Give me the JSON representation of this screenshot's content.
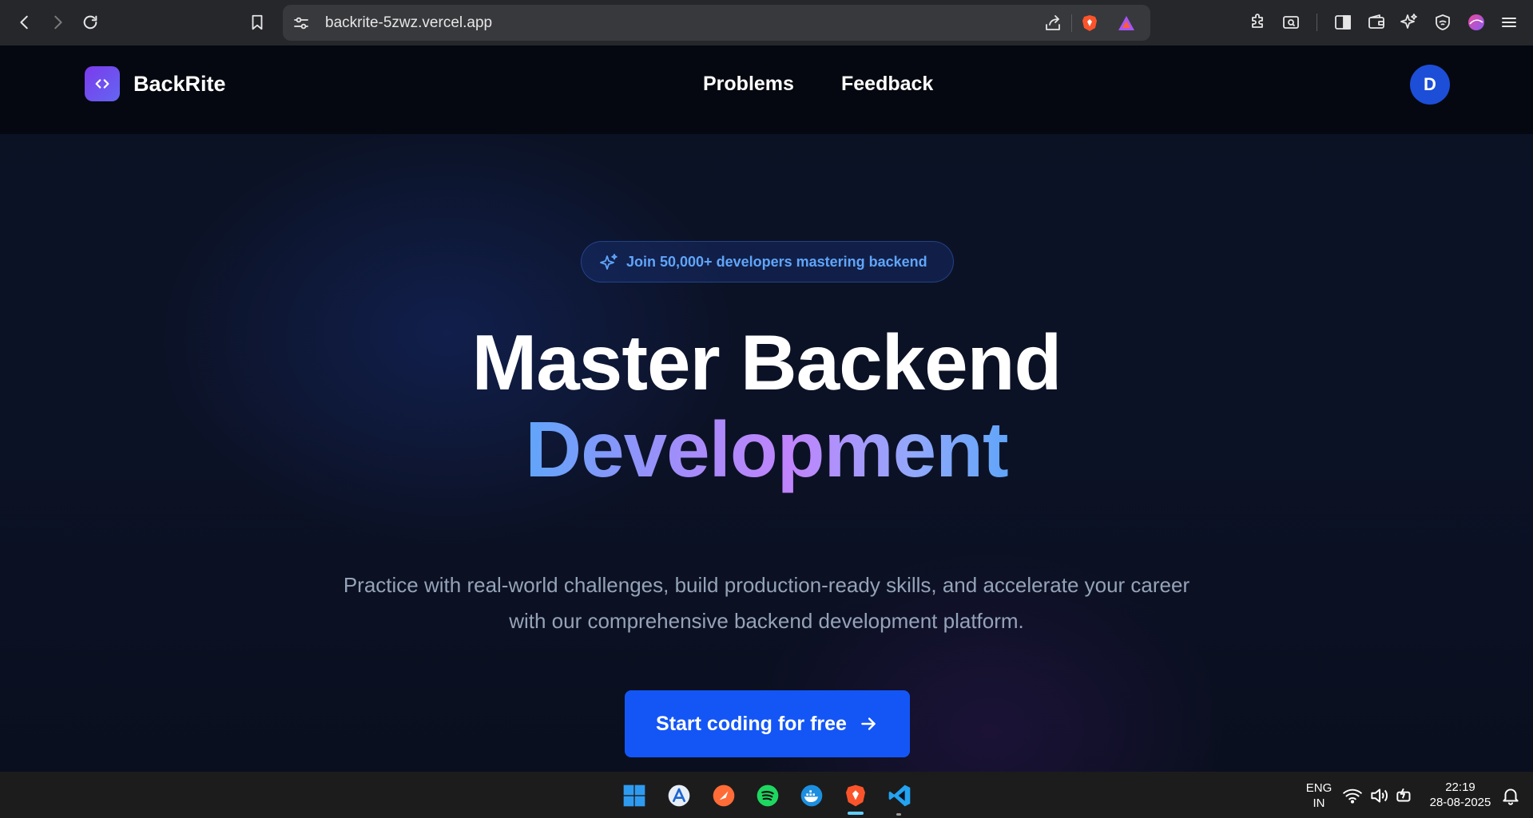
{
  "browser": {
    "url": "backrite-5zwz.vercel.app"
  },
  "site": {
    "brand": "BackRite",
    "nav": [
      {
        "label": "Problems"
      },
      {
        "label": "Feedback"
      }
    ],
    "avatar_initial": "D"
  },
  "hero": {
    "badge": "Join 50,000+ developers mastering backend",
    "headline_line1": "Master Backend",
    "headline_line2": "Development",
    "subtitle": "Practice with real-world challenges, build production-ready skills, and accelerate your career with our comprehensive backend development platform.",
    "cta_label": "Start coding for free"
  },
  "taskbar": {
    "language": "ENG",
    "region": "IN",
    "time": "22:19",
    "date": "28-08-2025"
  },
  "colors": {
    "accent": "#1456f5",
    "logo_gradient_start": "#7c3aed",
    "badge_text": "#60a5fa"
  }
}
